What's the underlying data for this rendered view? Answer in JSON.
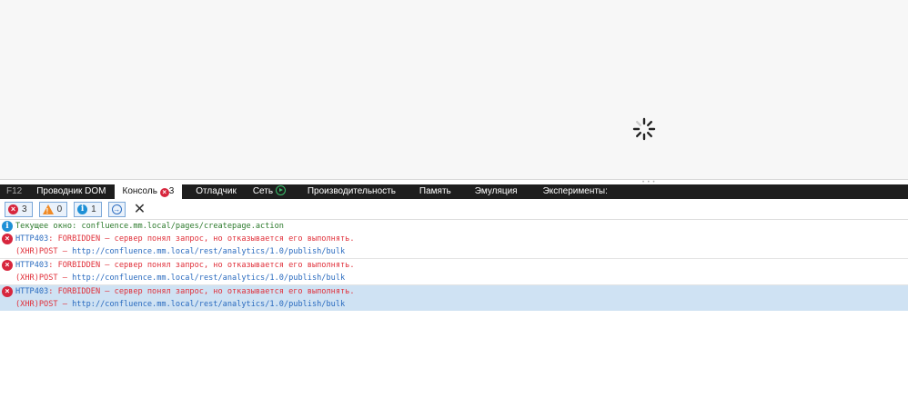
{
  "devtools": {
    "tabs": [
      {
        "label": "F12"
      },
      {
        "label": "Проводник DOM"
      },
      {
        "label": "Консоль",
        "badge": "3"
      },
      {
        "label": "Отладчик"
      },
      {
        "label": "Сеть"
      },
      {
        "label": "Производительность"
      },
      {
        "label": "Память"
      },
      {
        "label": "Эмуляция"
      },
      {
        "label": "Эксперименты:"
      }
    ],
    "filters": {
      "errors": "3",
      "warnings": "0",
      "info": "1"
    },
    "console": {
      "info": {
        "label": "Текущее окно:",
        "value": "confluence.mm.local/pages/createpage.action"
      },
      "errors": [
        {
          "code": "HTTP403",
          "message": ": FORBIDDEN — сервер понял запрос, но отказывается его выполнять.",
          "method": "(XHR)POST — ",
          "url": "http://confluence.mm.local/rest/analytics/1.0/publish/bulk"
        },
        {
          "code": "HTTP403",
          "message": ": FORBIDDEN — сервер понял запрос, но отказывается его выполнять.",
          "method": "(XHR)POST — ",
          "url": "http://confluence.mm.local/rest/analytics/1.0/publish/bulk"
        },
        {
          "code": "HTTP403",
          "message": ": FORBIDDEN — сервер понял запрос, но отказывается его выполнять.",
          "method": "(XHR)POST — ",
          "url": "http://confluence.mm.local/rest/analytics/1.0/publish/bulk"
        }
      ]
    }
  }
}
